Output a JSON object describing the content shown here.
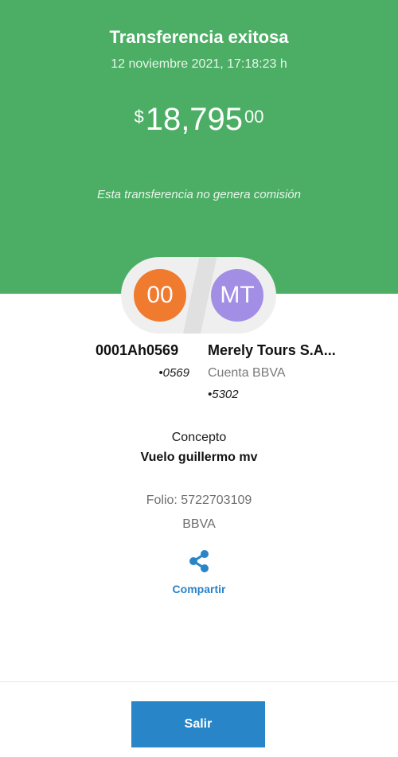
{
  "header": {
    "title": "Transferencia exitosa",
    "datetime": "12 noviembre 2021, 17:18:23 h",
    "amount": {
      "currency_symbol": "$",
      "integer": "18,795",
      "cents": "00"
    },
    "fee_note": "Esta transferencia no genera comisión"
  },
  "accounts": {
    "origin": {
      "initials": "00",
      "name": "0001Ah0569",
      "number": "•0569",
      "avatar_color": "#f07a2e"
    },
    "destination": {
      "initials": "MT",
      "name": "Merely Tours S.A...",
      "bank": "Cuenta BBVA",
      "number": "•5302",
      "avatar_color": "#a38ee6"
    }
  },
  "details": {
    "concept_label": "Concepto",
    "concept_value": "Vuelo guillermo mv",
    "folio": "Folio: 5722703109",
    "bank": "BBVA"
  },
  "share": {
    "icon": "share-icon",
    "label": "Compartir"
  },
  "footer": {
    "exit_label": "Salir"
  },
  "colors": {
    "header_bg": "#4cae65",
    "accent_blue": "#2785c8"
  }
}
